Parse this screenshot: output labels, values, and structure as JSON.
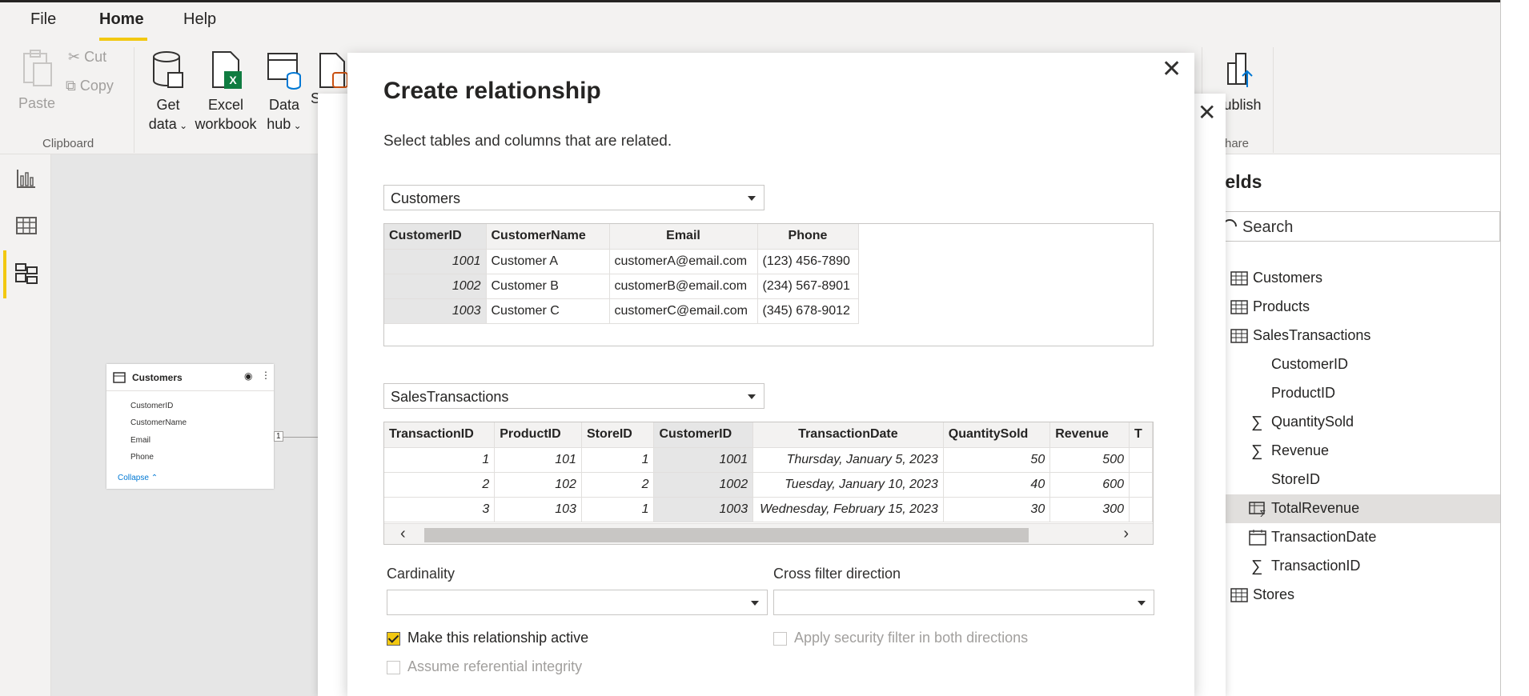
{
  "tabs": [
    {
      "label": "File"
    },
    {
      "label": "Home"
    },
    {
      "label": "Help"
    }
  ],
  "ribbon": {
    "paste": "Paste",
    "cut": "Cut",
    "copy": "Copy",
    "clipboard_group": "Clipboard",
    "get_data_1": "Get",
    "get_data_2": "data",
    "excel_1": "Excel",
    "excel_2": "workbook",
    "datahub_1": "Data",
    "datahub_2": "hub",
    "partial_s": "S",
    "publish": "ublish",
    "share_group": "hare"
  },
  "model": {
    "table_title": "Customers",
    "fields": [
      "CustomerID",
      "CustomerName",
      "Email",
      "Phone"
    ],
    "collapse": "Collapse",
    "rel_one": "1"
  },
  "fields_pane": {
    "title": "ields",
    "search_placeholder": "Search",
    "items": [
      {
        "label": "Customers",
        "icon": "table-icon"
      },
      {
        "label": "Products",
        "icon": "table-icon"
      },
      {
        "label": "SalesTransactions",
        "icon": "table-icon"
      },
      {
        "label": "CustomerID",
        "icon": "none"
      },
      {
        "label": "ProductID",
        "icon": "none"
      },
      {
        "label": "QuantitySold",
        "icon": "sigma-icon"
      },
      {
        "label": "Revenue",
        "icon": "sigma-icon"
      },
      {
        "label": "StoreID",
        "icon": "none"
      },
      {
        "label": "TotalRevenue",
        "icon": "measure-table-icon"
      },
      {
        "label": "TransactionDate",
        "icon": "calendar-icon"
      },
      {
        "label": "TransactionID",
        "icon": "sigma-icon"
      },
      {
        "label": "Stores",
        "icon": "table-icon"
      }
    ]
  },
  "dialog": {
    "title": "Create relationship",
    "subtitle": "Select tables and columns that are related.",
    "table1_select": "Customers",
    "table1": {
      "headers": [
        "CustomerID",
        "CustomerName",
        "Email",
        "Phone"
      ],
      "rows": [
        [
          "1001",
          "Customer A",
          "customerA@email.com",
          "(123) 456-7890"
        ],
        [
          "1002",
          "Customer B",
          "customerB@email.com",
          "(234) 567-8901"
        ],
        [
          "1003",
          "Customer C",
          "customerC@email.com",
          "(345) 678-9012"
        ]
      ]
    },
    "table2_select": "SalesTransactions",
    "table2": {
      "headers": [
        "TransactionID",
        "ProductID",
        "StoreID",
        "CustomerID",
        "TransactionDate",
        "QuantitySold",
        "Revenue",
        "T"
      ],
      "rows": [
        [
          "1",
          "101",
          "1",
          "1001",
          "Thursday, January 5, 2023",
          "50",
          "500",
          ""
        ],
        [
          "2",
          "102",
          "2",
          "1002",
          "Tuesday, January 10, 2023",
          "40",
          "600",
          ""
        ],
        [
          "3",
          "103",
          "1",
          "1003",
          "Wednesday, February 15, 2023",
          "30",
          "300",
          ""
        ]
      ]
    },
    "cardinality_label": "Cardinality",
    "cross_filter_label": "Cross filter direction",
    "make_active": "Make this relationship active",
    "make_active_checked": true,
    "apply_security": "Apply security filter in both directions",
    "referential": "Assume referential integrity"
  }
}
